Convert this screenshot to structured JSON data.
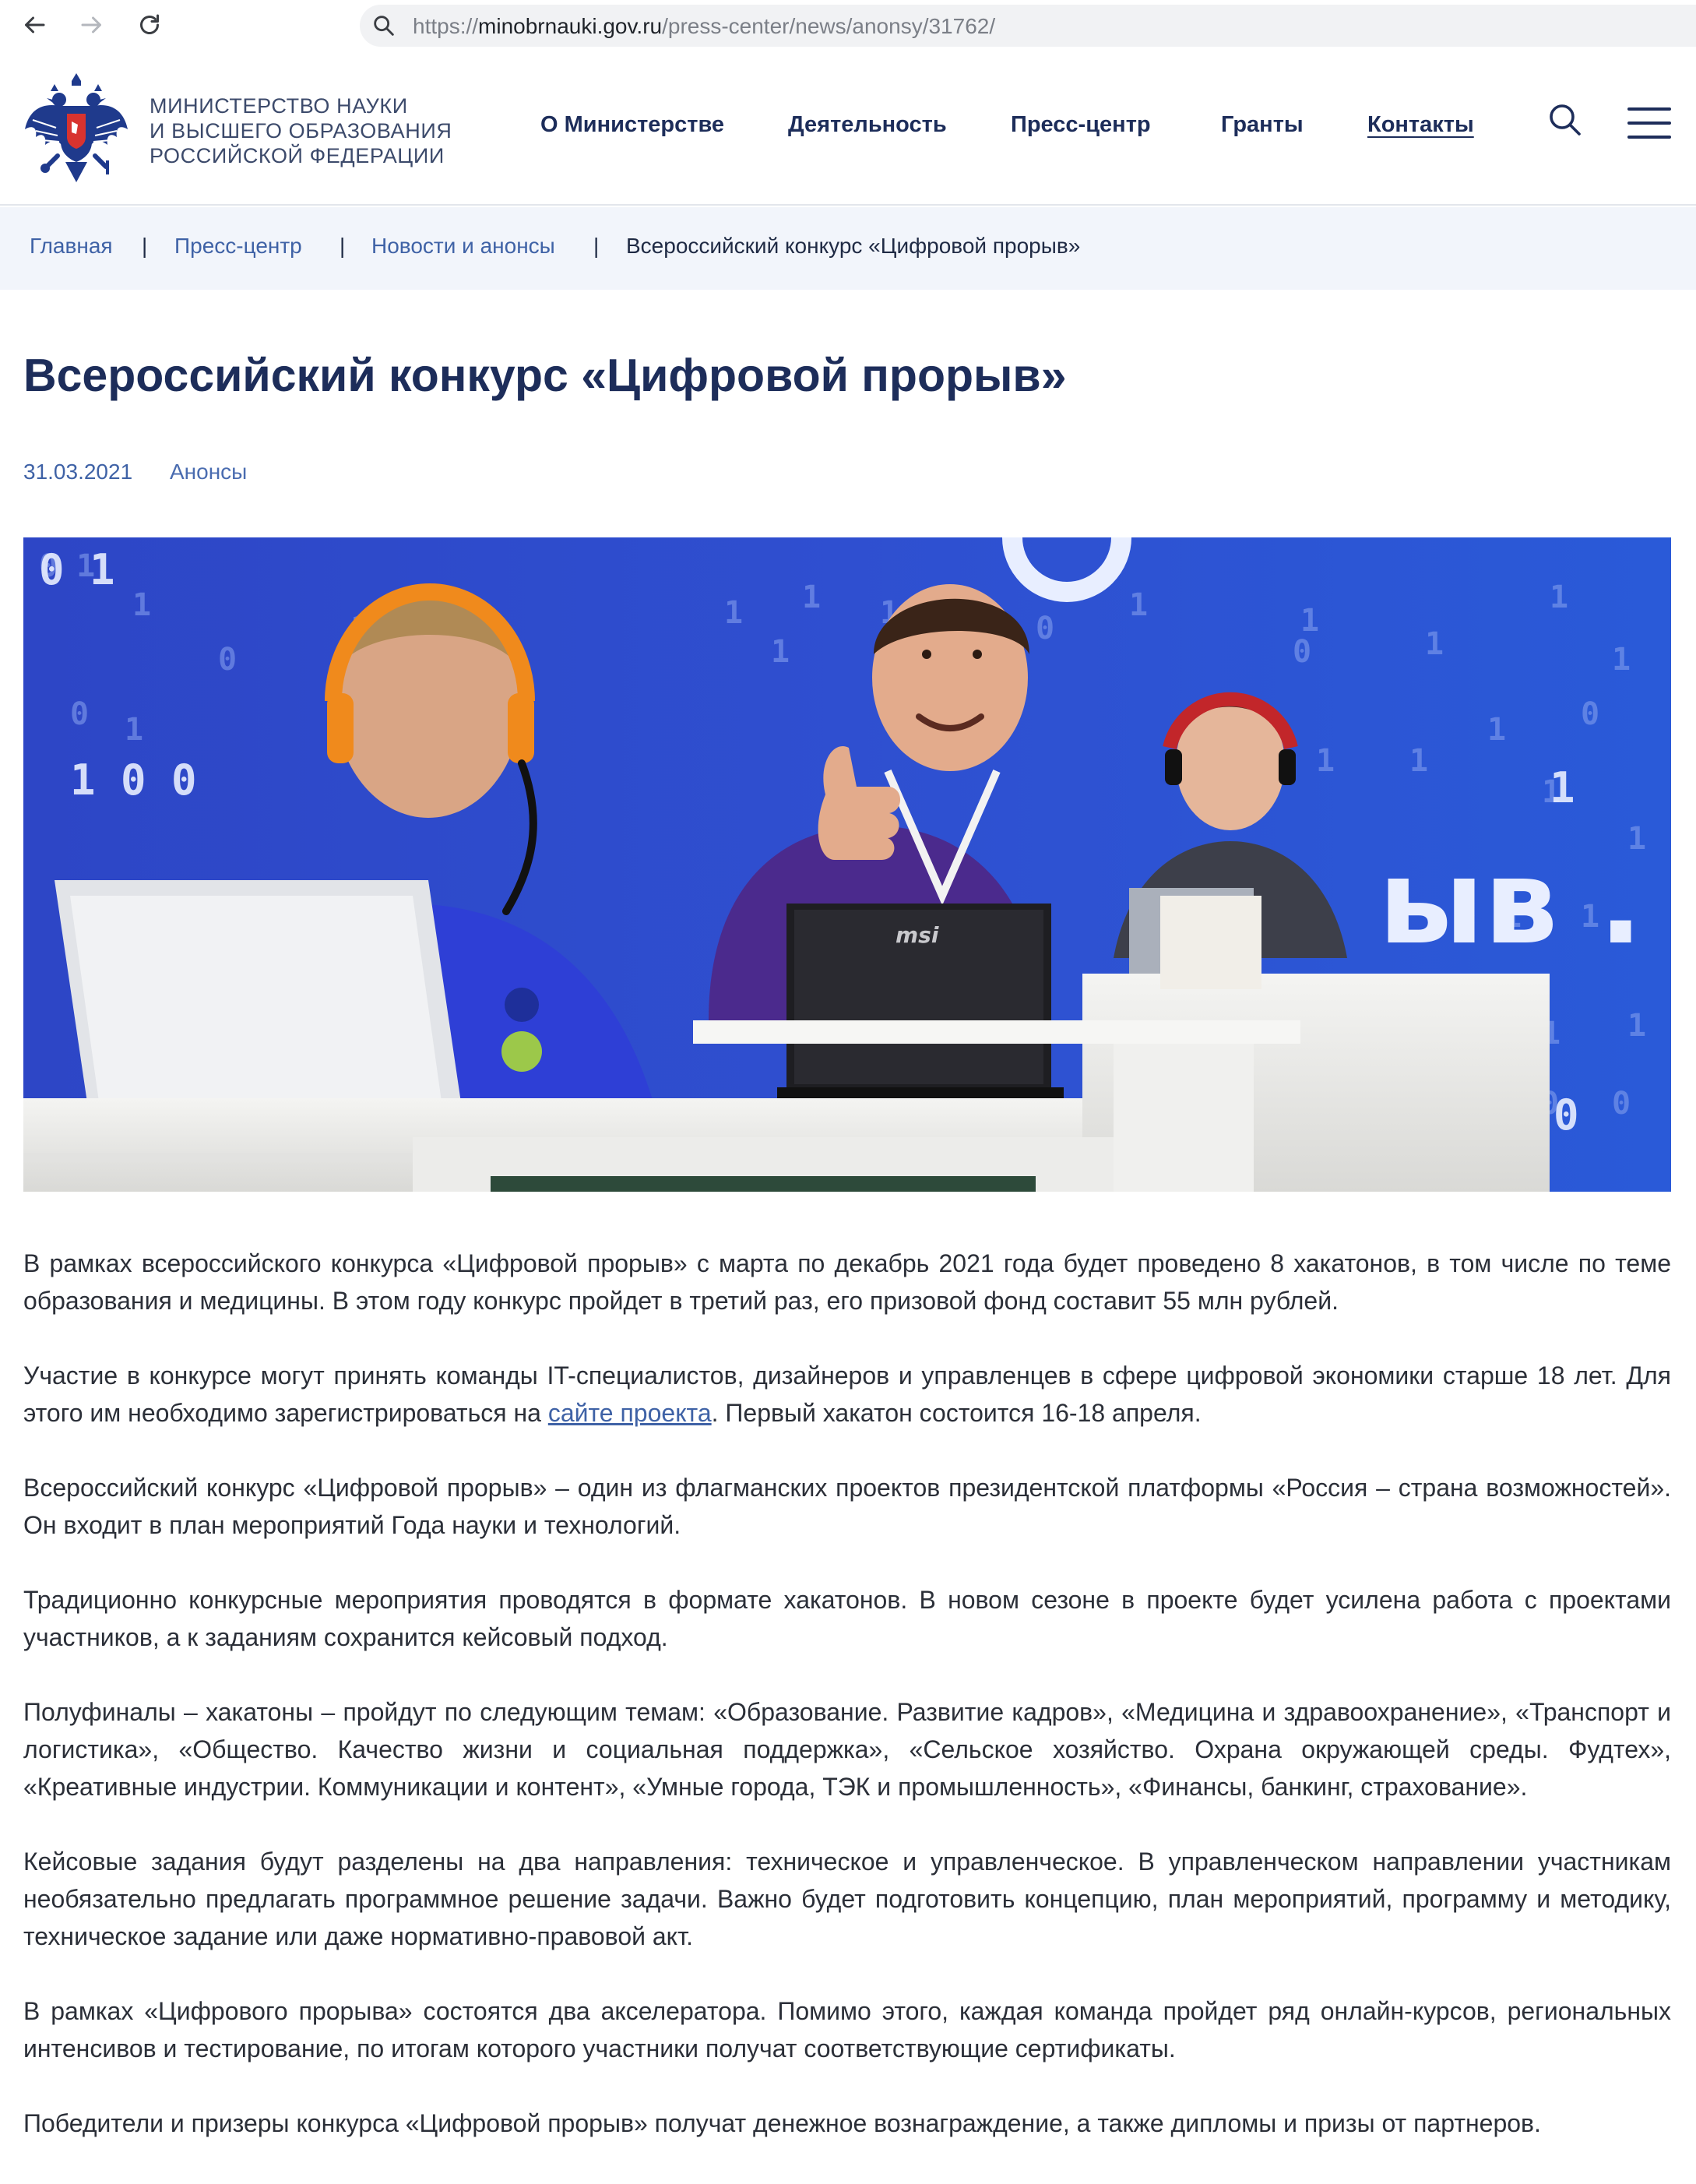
{
  "browser": {
    "url_prefix": "https://",
    "url_host": "minobrnauki.gov.ru",
    "url_path": "/press-center/news/anonsy/31762/"
  },
  "header": {
    "ministry_line1": "Министерство науки",
    "ministry_line2": "и высшего образования",
    "ministry_line3": "Российской Федерации",
    "nav": [
      "О Министерстве",
      "Деятельность",
      "Пресс-центр",
      "Гранты",
      "Контакты"
    ]
  },
  "breadcrumb": {
    "items": [
      "Главная",
      "Пресс-центр",
      "Новости и анонсы"
    ],
    "separator": "|",
    "current": "Всероссийский конкурс «Цифровой прорыв»"
  },
  "article": {
    "title": "Всероссийский конкурс «Цифровой прорыв»",
    "date": "31.03.2021",
    "tag": "Анонсы",
    "hero_text_1": "ыв . р",
    "hero_laptop_brand": "msi",
    "p1": "В рамках всероссийского конкурса «Цифровой прорыв» с марта по декабрь 2021 года будет проведено 8 хакатонов, в том числе по теме образования и медицины. В этом году конкурс пройдет в третий раз, его призовой фонд составит 55 млн рублей.",
    "p2_before": "Участие в конкурсе могут принять команды IT-специалистов, дизайнеров и управленцев в сфере цифровой экономики старше 18 лет. Для этого им необходимо зарегистрироваться на ",
    "p2_link": "сайте проекта",
    "p2_after": ". Первый хакатон состоится 16-18 апреля.",
    "p3": "Всероссийский конкурс «Цифровой прорыв» – один из флагманских проектов президентской платформы «Россия – страна возможностей». Он входит в план мероприятий Года науки и технологий.",
    "p4": "Традиционно конкурсные мероприятия проводятся в формате хакатонов. В новом сезоне в проекте будет усилена работа с проектами участников, а к заданиям сохранится кейсовый подход.",
    "p5": "Полуфиналы – хакатоны – пройдут по следующим темам: «Образование. Развитие кадров», «Медицина и здравоохранение», «Транспорт и логистика», «Общество. Качество жизни и социальная поддержка», «Сельское хозяйство. Охрана окружающей среды. Фудтех», «Креативные индустрии. Коммуникации и контент», «Умные города, ТЭК и промышленность», «Финансы, банкинг, страхование».",
    "p6": "Кейсовые задания будут разделены на два направления: техническое и управленческое. В управленческом направлении участникам необязательно предлагать программное решение задачи. Важно будет подготовить концепцию, план мероприятий, программу и методику, техническое задание или даже нормативно-правовой акт.",
    "p7": "В рамках «Цифрового прорыва» состоятся два акселератора. Помимо этого, каждая команда пройдет ряд онлайн-курсов, региональных интенсивов и тестирование, по итогам которого участники получат соответствующие сертификаты.",
    "p8": "Победители и призеры конкурса «Цифровой прорыв» получат денежное вознаграждение, а также дипломы и призы от партнеров."
  },
  "colors": {
    "brand_navy": "#1d2d5a",
    "link_blue": "#3f62a6",
    "breadcrumb_bg": "#f2f5fb",
    "hero_blue": "#2a49c9"
  },
  "icons": [
    "back-arrow-icon",
    "forward-arrow-icon",
    "reload-icon",
    "search-icon",
    "hamburger-menu-icon",
    "coat-of-arms-emblem"
  ]
}
